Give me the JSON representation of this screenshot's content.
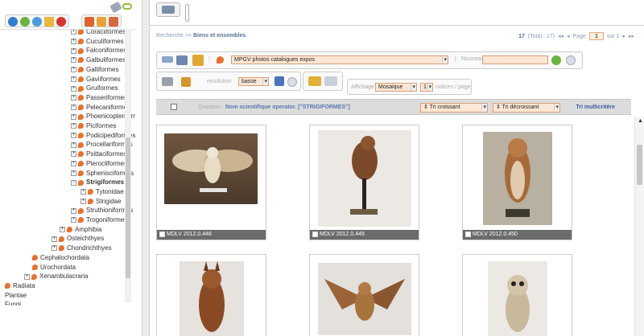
{
  "tree": {
    "nodes": [
      {
        "label": "Coraciiformes",
        "bold": false
      },
      {
        "label": "Cuculiformes",
        "bold": false
      },
      {
        "label": "Falconiformes",
        "bold": false
      },
      {
        "label": "Galbuliformes",
        "bold": false
      },
      {
        "label": "Galliformes",
        "bold": false
      },
      {
        "label": "Gaviiformes",
        "bold": false
      },
      {
        "label": "Gruiformes",
        "bold": false
      },
      {
        "label": "Passeriformes",
        "bold": false
      },
      {
        "label": "Pelecaniformes",
        "bold": false
      },
      {
        "label": "Phoenicopteriformes",
        "bold": false
      },
      {
        "label": "Piciformes",
        "bold": false
      },
      {
        "label": "Podicipediformes",
        "bold": false
      },
      {
        "label": "Procellariformes",
        "bold": false
      },
      {
        "label": "Psittaciformes",
        "bold": false
      },
      {
        "label": "Pterocliformes",
        "bold": false
      },
      {
        "label": "Sphenisciformes",
        "bold": false
      },
      {
        "label": "Strigiformes",
        "bold": true
      },
      {
        "label": "Tytonidae",
        "bold": false
      },
      {
        "label": "Strigidae",
        "bold": false
      },
      {
        "label": "Struthioniformes",
        "bold": false
      },
      {
        "label": "Trogoniformes",
        "bold": false
      },
      {
        "label": "Amphibia",
        "bold": false
      },
      {
        "label": "Osteichthyes",
        "bold": false
      },
      {
        "label": "Chondrichthyes",
        "bold": false
      },
      {
        "label": "Cephalochordata",
        "bold": false
      },
      {
        "label": "Urochordata",
        "bold": false
      },
      {
        "label": "Xenambulacraria",
        "bold": false
      },
      {
        "label": "Radiata",
        "bold": false
      },
      {
        "label": "Plantae",
        "bold": false
      },
      {
        "label": "Fungi",
        "bold": false
      }
    ]
  },
  "breadcrumb": {
    "root": "Recherche",
    "sep": ">>",
    "current": "Biens et ensembles"
  },
  "pager": {
    "count": "17",
    "total": "(Total : 17)",
    "page_label": "Page",
    "page_value": "1",
    "of": "sur 1"
  },
  "toolbar": {
    "catalogue_select": "MPGV photos catalogues expos",
    "nouveau_label": "Nouveau",
    "resolution_label": "résolution",
    "resolution_value": "basse",
    "affichage_label": "Affichage",
    "affichage_value": "Mosaique",
    "notices_value": "17",
    "notices_label": "notices / page"
  },
  "query": {
    "prefix": "Question :",
    "text": "Nom scientifique operator. [\"STRIGIFORMES\"]",
    "sort_asc": "⇕ Tri croissant",
    "sort_desc": "⇕ Tri décroissant",
    "multi": "Tri multicritère"
  },
  "cards": [
    {
      "caption": "MDLV 2012.0.448"
    },
    {
      "caption": "MDLV 2012.0.449"
    },
    {
      "caption": "MDLV 2012.0.450"
    },
    {
      "caption": ""
    },
    {
      "caption": ""
    },
    {
      "caption": ""
    }
  ],
  "colors": {
    "accent_orange": "#e8722a",
    "link_blue": "#3b5ca0",
    "select_bg": "#fde7d4"
  }
}
